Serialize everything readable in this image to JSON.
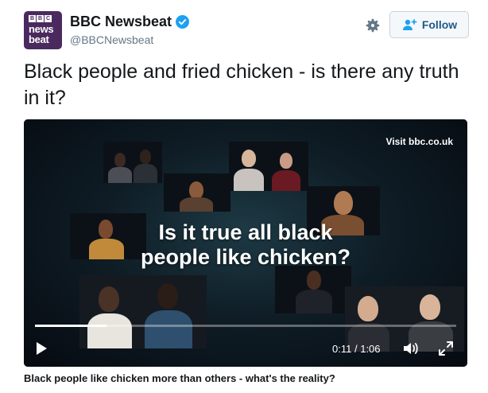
{
  "account": {
    "display_name": "BBC Newsbeat",
    "handle": "@BBCNewsbeat",
    "verified": true,
    "avatar_logo": {
      "blocks": [
        "B",
        "B",
        "C"
      ],
      "line1": "news",
      "line2": "beat"
    }
  },
  "actions": {
    "settings_icon": "gear-icon",
    "follow_label": "Follow"
  },
  "tweet": {
    "text": "Black people and fried chicken - is there any truth in it?"
  },
  "video": {
    "visit_label": "Visit bbc.co.uk",
    "headline_line1": "Is it true all black",
    "headline_line2": "people like chicken?",
    "current_time": "0:11",
    "separator": "/",
    "duration": "1:06",
    "progress": 0.17
  },
  "card": {
    "caption": "Black people like chicken more than others - what's the reality?"
  },
  "colors": {
    "brand_avatar": "#4a2a5e",
    "verified": "#1da1f2",
    "follow_text": "#1c5b87"
  }
}
